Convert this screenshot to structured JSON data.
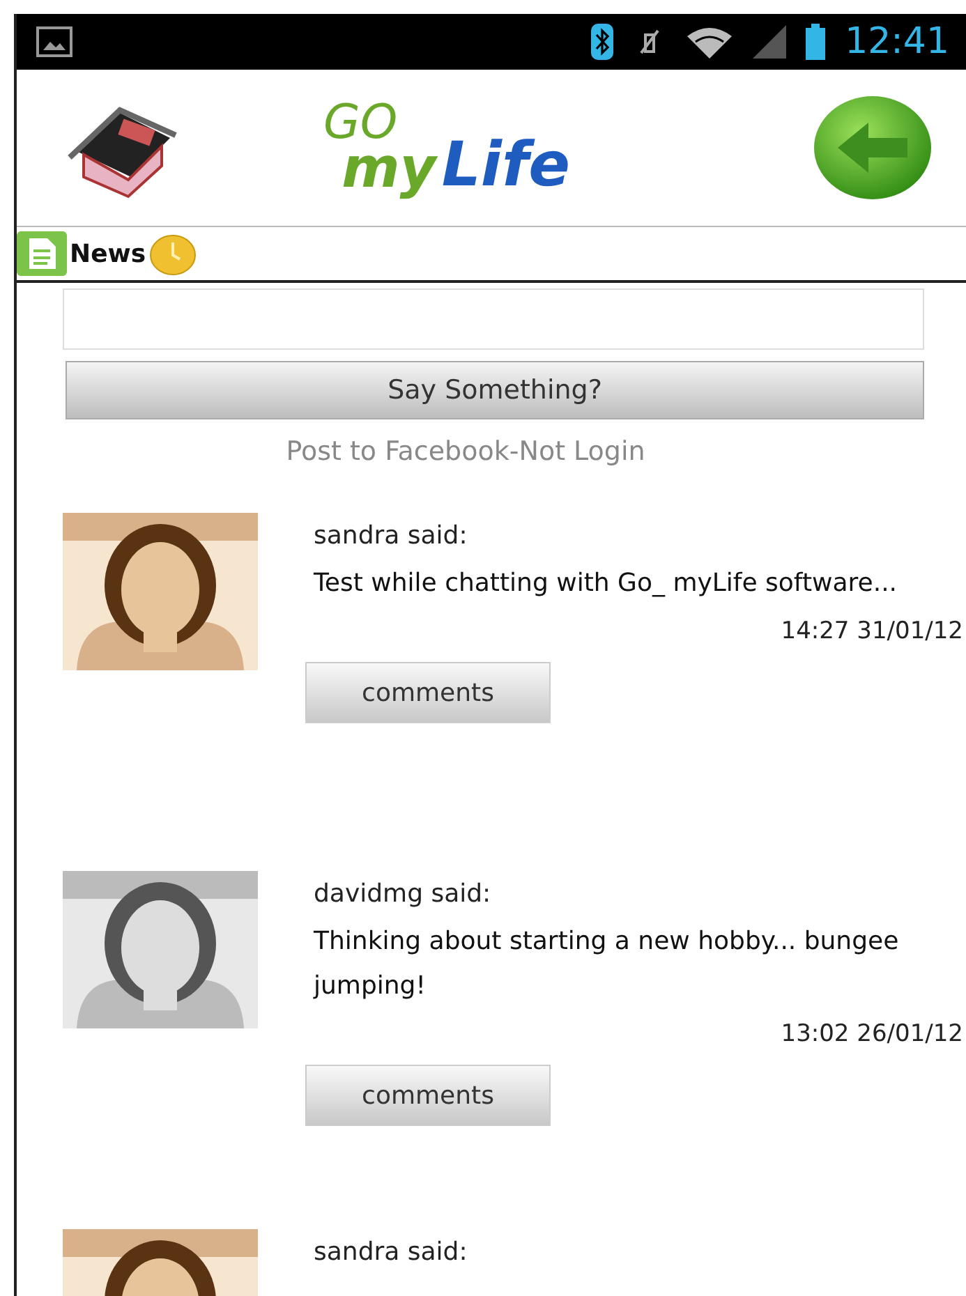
{
  "status_bar": {
    "time": "12:41"
  },
  "header": {
    "logo": [
      "GO",
      "my",
      "Life"
    ]
  },
  "section": {
    "title": "News"
  },
  "composer": {
    "button": "Say Something?",
    "facebook_note": "Post to Facebook-Not Login"
  },
  "posts": [
    {
      "author": "sandra said:",
      "message": "Test while chatting with Go_ myLife software...",
      "time": "14:27 31/01/12",
      "button": "comments"
    },
    {
      "author": "davidmg said:",
      "message": "Thinking about starting a new hobby... bungee jumping!",
      "time": "13:02 26/01/12",
      "button": "comments"
    },
    {
      "author": "sandra said:"
    }
  ]
}
